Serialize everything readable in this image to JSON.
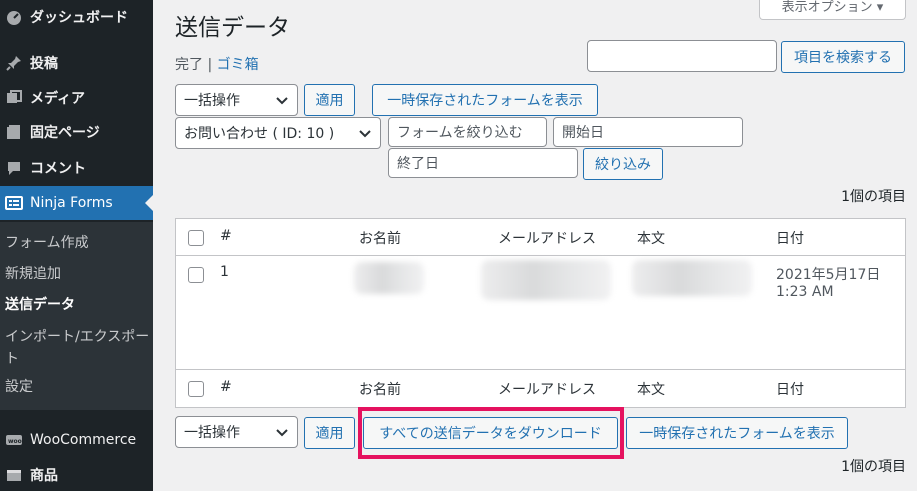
{
  "sidebar": {
    "items": [
      {
        "label": "ダッシュボード",
        "icon": "dashboard-icon"
      },
      {
        "label": "投稿",
        "icon": "pin-icon"
      },
      {
        "label": "メディア",
        "icon": "media-icon"
      },
      {
        "label": "固定ページ",
        "icon": "page-icon"
      },
      {
        "label": "コメント",
        "icon": "comment-icon"
      },
      {
        "label": "Ninja Forms",
        "icon": "ninja-forms-icon"
      },
      {
        "label": "WooCommerce",
        "icon": "woocommerce-icon"
      },
      {
        "label": "商品",
        "icon": "products-icon"
      }
    ],
    "submenu": [
      {
        "label": "フォーム作成"
      },
      {
        "label": "新規追加"
      },
      {
        "label": "送信データ"
      },
      {
        "label": "インポート/エクスポート"
      },
      {
        "label": "設定"
      }
    ]
  },
  "header": {
    "title": "送信データ",
    "screen_options": "表示オプション ▾",
    "status_links": {
      "complete": "完了",
      "separator": "|",
      "trash": "ゴミ箱"
    }
  },
  "search": {
    "value": "",
    "button": "項目を検索する"
  },
  "top_controls": {
    "bulk_action": "一括操作",
    "apply": "適用",
    "show_saved": "一時保存されたフォームを表示",
    "form_select": "お問い合わせ ( ID: 10 )",
    "filter_placeholder": "フォームを絞り込む",
    "start_date": "開始日",
    "end_date": "終了日",
    "filter_button": "絞り込み"
  },
  "item_count": "1個の項目",
  "table": {
    "columns": [
      "#",
      "お名前",
      "メールアドレス",
      "本文",
      "日付"
    ],
    "rows": [
      {
        "id": "1",
        "date_line1": "2021年5月17日",
        "date_line2": "1:23 AM"
      }
    ]
  },
  "bottom_controls": {
    "bulk_action": "一括操作",
    "apply": "適用",
    "download_all": "すべての送信データをダウンロード",
    "show_saved": "一時保存されたフォームを表示"
  },
  "colors": {
    "accent": "#2271b1",
    "sidebar": "#1d2327",
    "highlight": "#e5125f"
  }
}
